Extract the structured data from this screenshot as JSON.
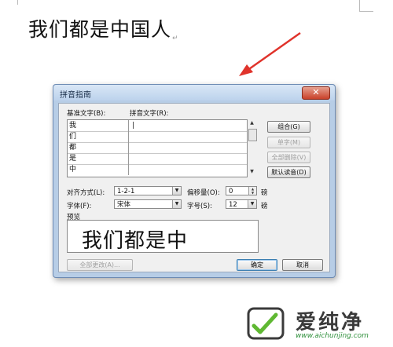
{
  "document": {
    "text": "我们都是中国人",
    "paragraph_mark": "↵"
  },
  "dialog": {
    "title": "拼音指南",
    "close_label": "✕",
    "base_text_label": "基准文字(B):",
    "ruby_text_label": "拼音文字(R):",
    "rows": [
      {
        "base": "我",
        "ruby": "|"
      },
      {
        "base": "们",
        "ruby": ""
      },
      {
        "base": "都",
        "ruby": ""
      },
      {
        "base": "是",
        "ruby": ""
      },
      {
        "base": "中",
        "ruby": ""
      }
    ],
    "buttons": {
      "group": "组合(G)",
      "mono": "单字(M)",
      "clear": "全部删除(V)",
      "default": "默认读音(D)",
      "change_all": "全部更改(A)...",
      "ok": "确定",
      "cancel": "取消"
    },
    "alignment_label": "对齐方式(L):",
    "alignment_value": "1-2-1",
    "offset_label": "偏移量(O):",
    "offset_value": "0",
    "offset_unit": "磅",
    "font_label": "字体(F):",
    "font_value": "宋体",
    "size_label": "字号(S):",
    "size_value": "12",
    "size_unit": "磅",
    "preview_label": "预览",
    "preview_text": "我们都是中"
  },
  "watermark": {
    "brand": "爱纯净",
    "url": "www.aichunjing.com"
  },
  "colors": {
    "arrow": "#e0332b",
    "dialog_frame": "#b7cde6"
  }
}
